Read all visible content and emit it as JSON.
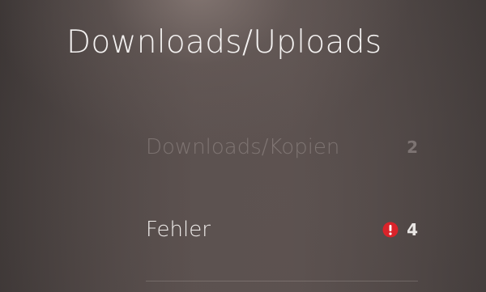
{
  "screen": {
    "title": "Downloads/Uploads"
  },
  "menu": {
    "items": [
      {
        "label": "Downloads/Kopien",
        "count": "2",
        "state": "dimmed"
      },
      {
        "label": "Fehler",
        "count": "4",
        "icon": "error-alert-icon",
        "icon_color": "#d9232a"
      }
    ]
  },
  "colors": {
    "alert": "#d9232a"
  }
}
